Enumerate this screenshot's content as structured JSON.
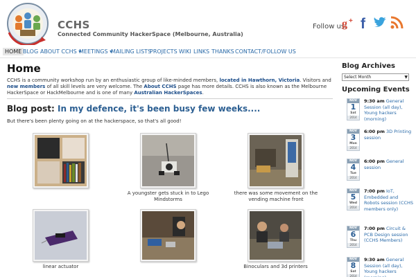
{
  "header": {
    "title": "CCHS",
    "tagline": "Connected Community HackerSpace (Melbourne, Australia)",
    "follow_label": "Follow us:",
    "social": [
      "google-plus-icon",
      "facebook-icon",
      "twitter-icon",
      "rss-icon"
    ]
  },
  "nav": {
    "items": [
      "HOME",
      "BLOG",
      "ABOUT CCHS ▾",
      "MEETINGS ▾",
      "MAILING LISTS",
      "PROJECTS",
      "WIKI",
      "LINKS",
      "THANKS",
      "CONTACT/FOLLOW US"
    ],
    "active": "HOME"
  },
  "main": {
    "title": "Home",
    "intro": {
      "t1": "CCHS is a community workshop run by an enthusiastic group of like-minded members, ",
      "link1": "located in Hawthorn, Victoria",
      "t2": ". Visitors and ",
      "link2": "new members",
      "t3": " of all skill levels are very welcome. The ",
      "link3": "About CCHS",
      "t4": " page has more details. CCHS is also known as the Melbourne HackerSpace or HackMelbourne and is one of many ",
      "link4": "Australian HackerSpaces",
      "t5": "."
    },
    "post": {
      "label": "Blog post:",
      "title": "In my defence, it's been busy few weeks....",
      "body": "But there's been plenty going on at the hackerspace, so that's all good!",
      "captions": [
        "",
        "A youngster gets stuck in to Lego Mindstorms",
        "there was some movement on the vending machine front",
        "linear actuator",
        "",
        "Binoculars and 3d printers"
      ]
    }
  },
  "sidebar": {
    "archives_title": "Blog Archives",
    "select_value": "Select Month",
    "events_title": "Upcoming Events",
    "events": [
      {
        "mon": "NOV",
        "day": "1",
        "dow": "Sat",
        "yr": "2014",
        "time": "9:30 am",
        "text": "General Session (all day), Young hackers (morning)"
      },
      {
        "mon": "NOV",
        "day": "3",
        "dow": "Mon",
        "yr": "2014",
        "time": "6:00 pm",
        "text": "3D Printing session"
      },
      {
        "mon": "NOV",
        "day": "4",
        "dow": "Tue",
        "yr": "2014",
        "time": "6:00 pm",
        "text": "General session"
      },
      {
        "mon": "NOV",
        "day": "5",
        "dow": "Wed",
        "yr": "2014",
        "time": "7:00 pm",
        "text": "IoT, Embedded and Robots session (CCHS members only)"
      },
      {
        "mon": "NOV",
        "day": "6",
        "dow": "Thu",
        "yr": "2014",
        "time": "7:00 pm",
        "text": "Circuit & PCB Design session (CCHS Members)"
      },
      {
        "mon": "NOV",
        "day": "8",
        "dow": "Sat",
        "yr": "2014",
        "time": "9:30 am",
        "text": "General Session (all day), Young hackers (morning)"
      }
    ]
  },
  "colors": {
    "link": "#2a6aa8",
    "post_title": "#2c5f92",
    "calendar_header": "#8aa0b4"
  }
}
